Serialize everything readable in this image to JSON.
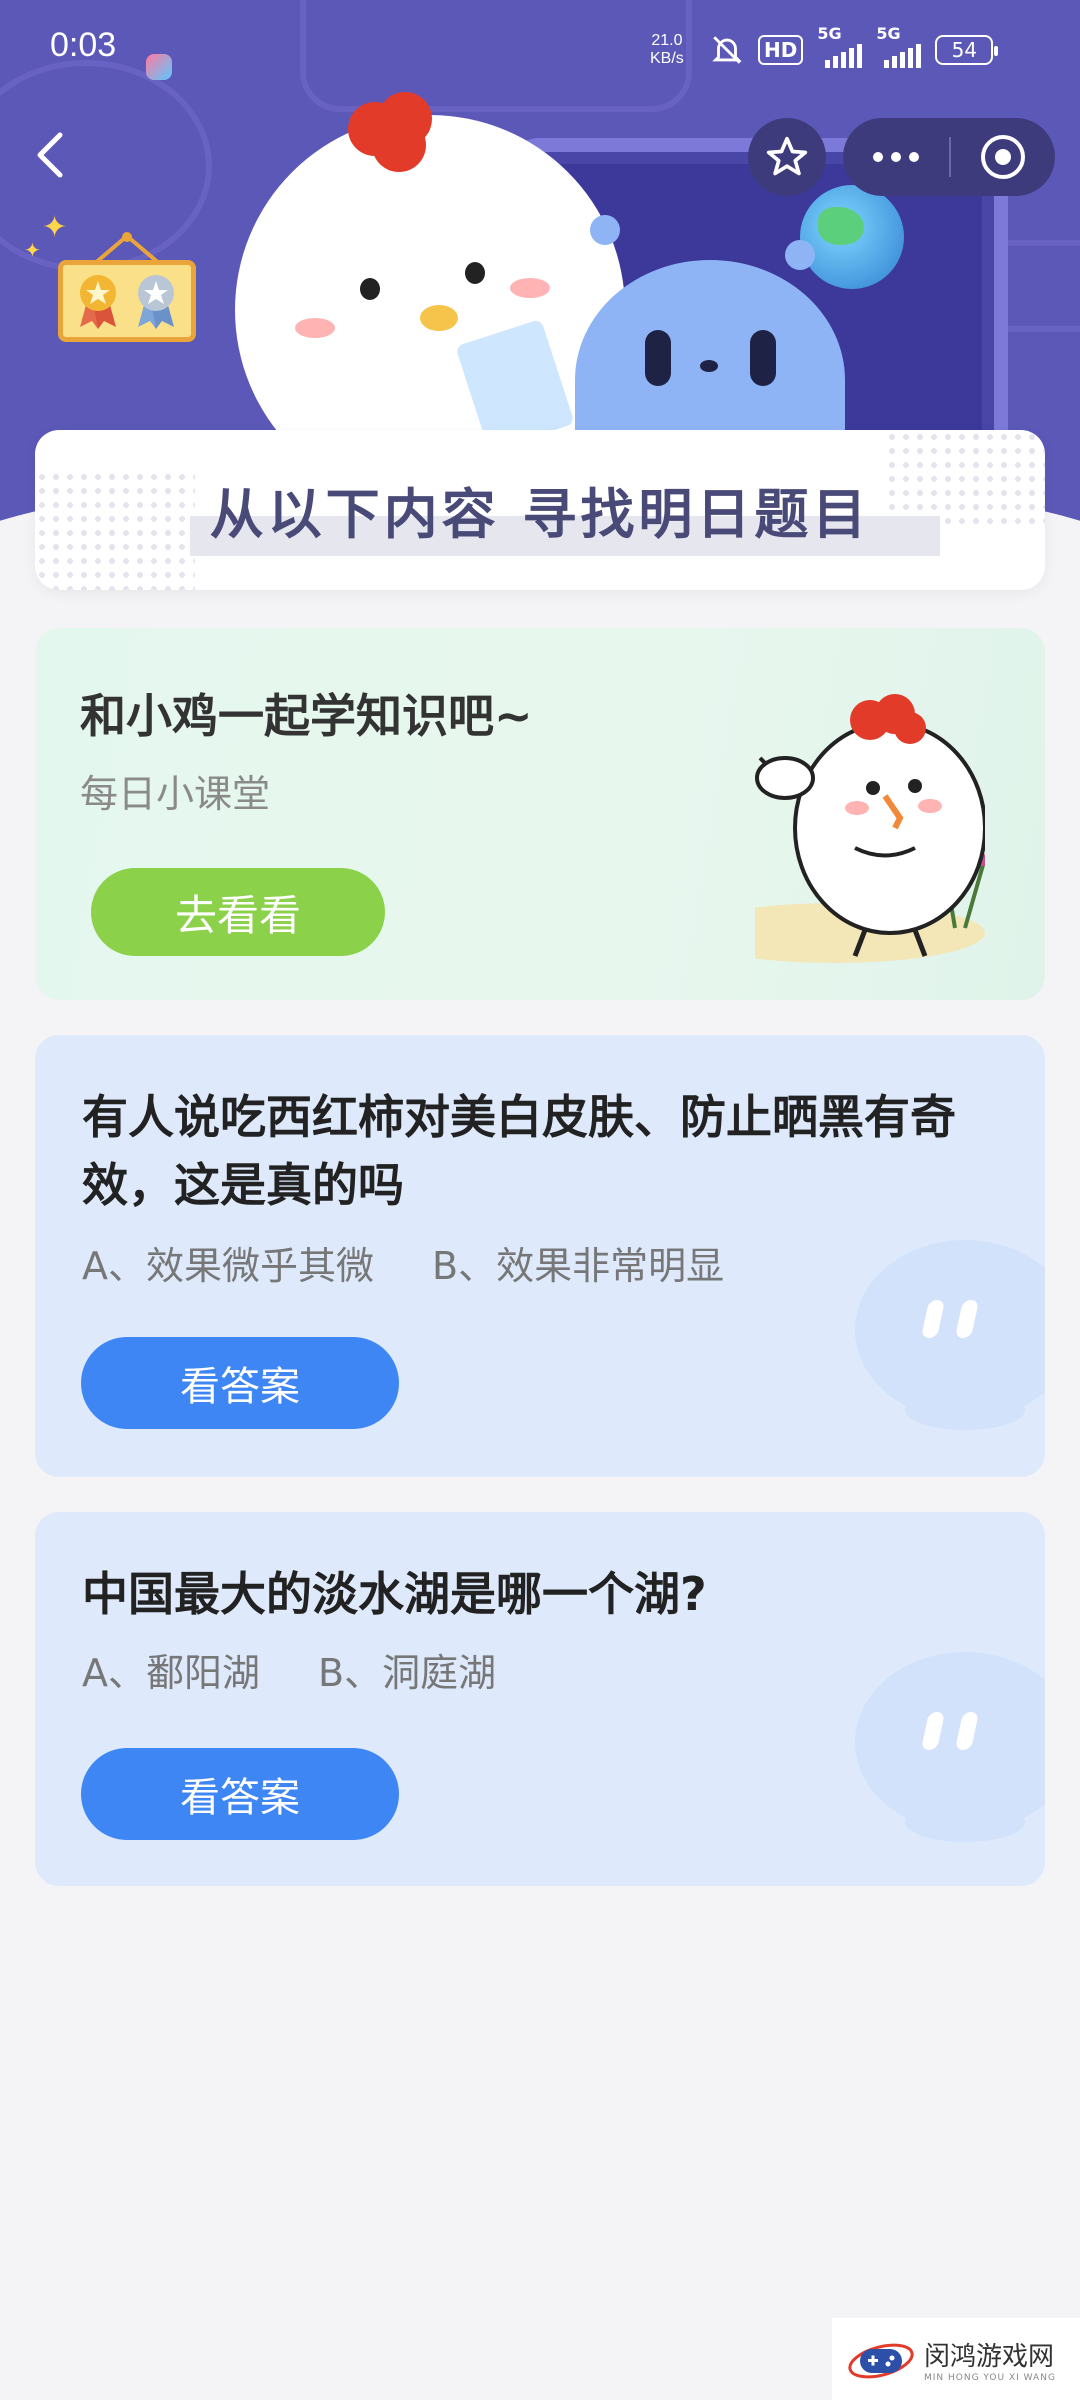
{
  "status_bar": {
    "time": "0:03",
    "speed_value": "21.0",
    "speed_unit": "KB/s",
    "hd": "HD",
    "network1": "5G",
    "network2": "5G",
    "battery": "54"
  },
  "banner": {
    "title": "从以下内容 寻找明日题目"
  },
  "learn_card": {
    "title": "和小鸡一起学知识吧~",
    "subtitle": "每日小课堂",
    "button": "去看看"
  },
  "questions": [
    {
      "question": "有人说吃西红柿对美白皮肤、防止晒黑有奇效，这是真的吗",
      "option_a": "A、效果微乎其微",
      "option_b": "B、效果非常明显",
      "button": "看答案"
    },
    {
      "question": "中国最大的淡水湖是哪一个湖?",
      "option_a": "A、鄱阳湖",
      "option_b": "B、洞庭湖",
      "button": "看答案"
    }
  ],
  "watermark": {
    "name": "闵鸿游戏网",
    "pinyin": "MIN HONG YOU XI WANG"
  },
  "colors": {
    "header_bg": "#5c58b8",
    "primary_blue": "#3d86f3",
    "green": "#8bd14a",
    "card_blue": "#deeafc"
  }
}
